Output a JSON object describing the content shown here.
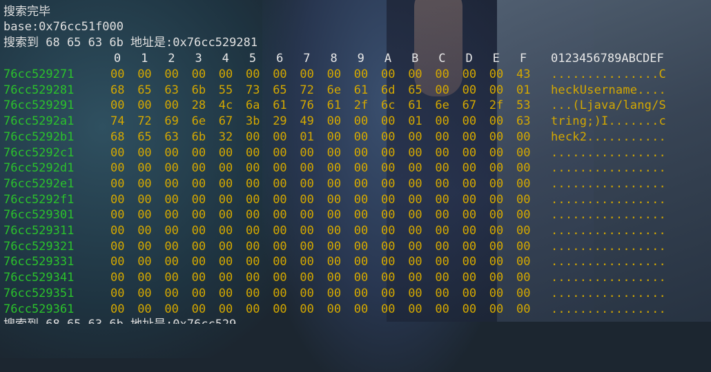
{
  "status": {
    "line1": "搜索完毕",
    "line2": "base:0x76cc51f000",
    "line3": "搜索到 68 65 63 6b 地址是:0x76cc529281",
    "cutoff": "搜索到 68 65 63 6b 地址是:0x76cc529"
  },
  "header": {
    "columns": [
      "0",
      "1",
      "2",
      "3",
      "4",
      "5",
      "6",
      "7",
      "8",
      "9",
      "A",
      "B",
      "C",
      "D",
      "E",
      "F"
    ],
    "ascii_header": "0123456789ABCDEF"
  },
  "colors": {
    "address": "#2bc22b",
    "bytes": "#d4a800",
    "header": "#e8e8e8",
    "text": "#e0e0e0"
  },
  "rows": [
    {
      "addr": "76cc529271",
      "bytes": [
        "00",
        "00",
        "00",
        "00",
        "00",
        "00",
        "00",
        "00",
        "00",
        "00",
        "00",
        "00",
        "00",
        "00",
        "00",
        "43"
      ],
      "ascii": "...............C"
    },
    {
      "addr": "76cc529281",
      "bytes": [
        "68",
        "65",
        "63",
        "6b",
        "55",
        "73",
        "65",
        "72",
        "6e",
        "61",
        "6d",
        "65",
        "00",
        "00",
        "00",
        "01"
      ],
      "ascii": "heckUsername...."
    },
    {
      "addr": "76cc529291",
      "bytes": [
        "00",
        "00",
        "00",
        "28",
        "4c",
        "6a",
        "61",
        "76",
        "61",
        "2f",
        "6c",
        "61",
        "6e",
        "67",
        "2f",
        "53"
      ],
      "ascii": "...(Ljava/lang/S"
    },
    {
      "addr": "76cc5292a1",
      "bytes": [
        "74",
        "72",
        "69",
        "6e",
        "67",
        "3b",
        "29",
        "49",
        "00",
        "00",
        "00",
        "01",
        "00",
        "00",
        "00",
        "63"
      ],
      "ascii": "tring;)I.......c"
    },
    {
      "addr": "76cc5292b1",
      "bytes": [
        "68",
        "65",
        "63",
        "6b",
        "32",
        "00",
        "00",
        "01",
        "00",
        "00",
        "00",
        "00",
        "00",
        "00",
        "00",
        "00"
      ],
      "ascii": "heck2..........."
    },
    {
      "addr": "76cc5292c1",
      "bytes": [
        "00",
        "00",
        "00",
        "00",
        "00",
        "00",
        "00",
        "00",
        "00",
        "00",
        "00",
        "00",
        "00",
        "00",
        "00",
        "00"
      ],
      "ascii": "................"
    },
    {
      "addr": "76cc5292d1",
      "bytes": [
        "00",
        "00",
        "00",
        "00",
        "00",
        "00",
        "00",
        "00",
        "00",
        "00",
        "00",
        "00",
        "00",
        "00",
        "00",
        "00"
      ],
      "ascii": "................"
    },
    {
      "addr": "76cc5292e1",
      "bytes": [
        "00",
        "00",
        "00",
        "00",
        "00",
        "00",
        "00",
        "00",
        "00",
        "00",
        "00",
        "00",
        "00",
        "00",
        "00",
        "00"
      ],
      "ascii": "................"
    },
    {
      "addr": "76cc5292f1",
      "bytes": [
        "00",
        "00",
        "00",
        "00",
        "00",
        "00",
        "00",
        "00",
        "00",
        "00",
        "00",
        "00",
        "00",
        "00",
        "00",
        "00"
      ],
      "ascii": "................"
    },
    {
      "addr": "76cc529301",
      "bytes": [
        "00",
        "00",
        "00",
        "00",
        "00",
        "00",
        "00",
        "00",
        "00",
        "00",
        "00",
        "00",
        "00",
        "00",
        "00",
        "00"
      ],
      "ascii": "................"
    },
    {
      "addr": "76cc529311",
      "bytes": [
        "00",
        "00",
        "00",
        "00",
        "00",
        "00",
        "00",
        "00",
        "00",
        "00",
        "00",
        "00",
        "00",
        "00",
        "00",
        "00"
      ],
      "ascii": "................"
    },
    {
      "addr": "76cc529321",
      "bytes": [
        "00",
        "00",
        "00",
        "00",
        "00",
        "00",
        "00",
        "00",
        "00",
        "00",
        "00",
        "00",
        "00",
        "00",
        "00",
        "00"
      ],
      "ascii": "................"
    },
    {
      "addr": "76cc529331",
      "bytes": [
        "00",
        "00",
        "00",
        "00",
        "00",
        "00",
        "00",
        "00",
        "00",
        "00",
        "00",
        "00",
        "00",
        "00",
        "00",
        "00"
      ],
      "ascii": "................"
    },
    {
      "addr": "76cc529341",
      "bytes": [
        "00",
        "00",
        "00",
        "00",
        "00",
        "00",
        "00",
        "00",
        "00",
        "00",
        "00",
        "00",
        "00",
        "00",
        "00",
        "00"
      ],
      "ascii": "................"
    },
    {
      "addr": "76cc529351",
      "bytes": [
        "00",
        "00",
        "00",
        "00",
        "00",
        "00",
        "00",
        "00",
        "00",
        "00",
        "00",
        "00",
        "00",
        "00",
        "00",
        "00"
      ],
      "ascii": "................"
    },
    {
      "addr": "76cc529361",
      "bytes": [
        "00",
        "00",
        "00",
        "00",
        "00",
        "00",
        "00",
        "00",
        "00",
        "00",
        "00",
        "00",
        "00",
        "00",
        "00",
        "00"
      ],
      "ascii": "................"
    }
  ]
}
